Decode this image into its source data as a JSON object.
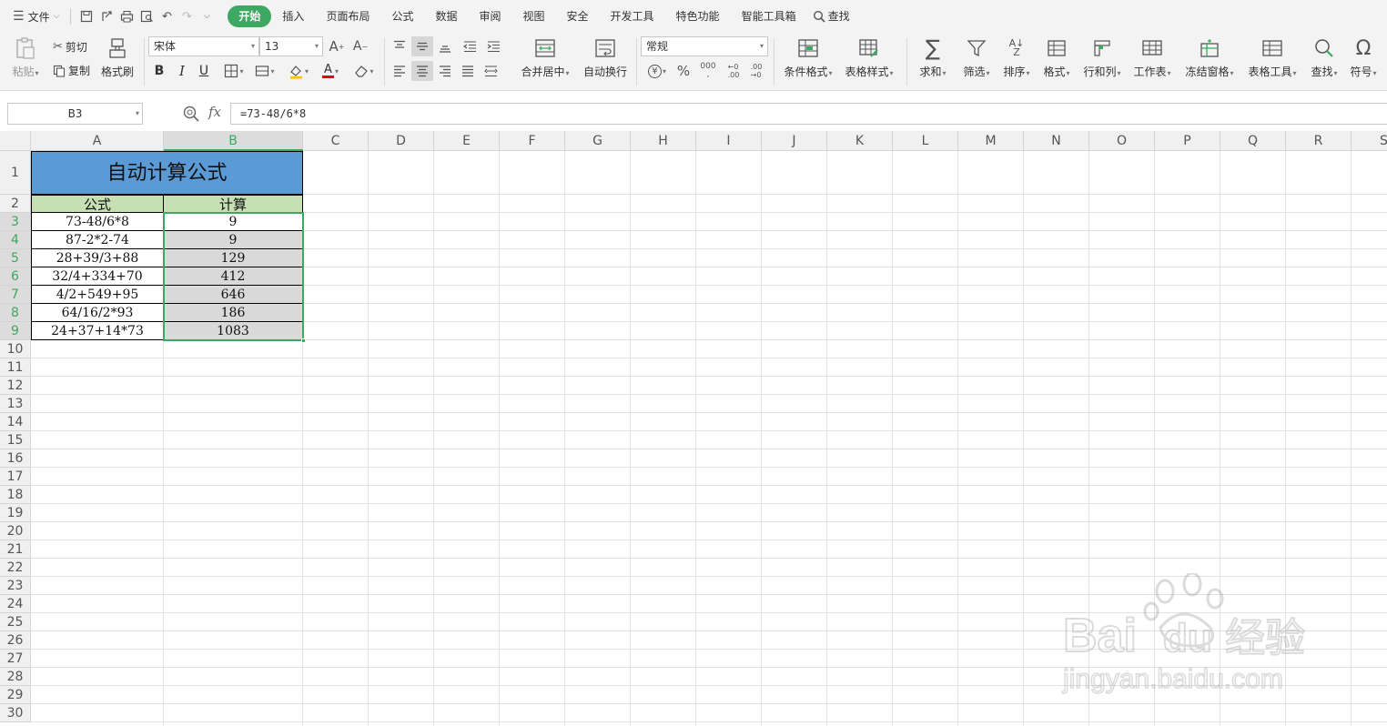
{
  "menu": {
    "file_label": "文件",
    "tabs": [
      "开始",
      "插入",
      "页面布局",
      "公式",
      "数据",
      "审阅",
      "视图",
      "安全",
      "开发工具",
      "特色功能",
      "智能工具箱"
    ],
    "active_tab": "开始",
    "search_label": "查找"
  },
  "ribbon": {
    "paste": "粘贴",
    "cut": "剪切",
    "copy": "复制",
    "format_painter": "格式刷",
    "font_name": "宋体",
    "font_size": "13",
    "merge_center": "合并居中",
    "wrap_text": "自动换行",
    "number_format": "常规",
    "conditional_format": "条件格式",
    "table_style": "表格样式",
    "sum": "求和",
    "filter": "筛选",
    "sort": "排序",
    "format": "格式",
    "rows_cols": "行和列",
    "worksheet": "工作表",
    "freeze": "冻结窗格",
    "table_tools": "表格工具",
    "find": "查找",
    "symbol": "符号"
  },
  "formula_bar": {
    "name_box": "B3",
    "fx": "fx",
    "formula": "=73-48/6*8"
  },
  "sheet": {
    "columns": [
      "A",
      "B",
      "C",
      "D",
      "E",
      "F",
      "G",
      "H",
      "I",
      "J",
      "K",
      "L",
      "M",
      "N",
      "O",
      "P",
      "Q",
      "R",
      "S"
    ],
    "selected_column": "B",
    "title": "自动计算公式",
    "header_formula": "公式",
    "header_calc": "计算",
    "rows": [
      {
        "formula": "73-48/6*8",
        "result": "9"
      },
      {
        "formula": "87-2*2-74",
        "result": "9"
      },
      {
        "formula": "28+39/3+88",
        "result": "129"
      },
      {
        "formula": "32/4+334+70",
        "result": "412"
      },
      {
        "formula": "4/2+549+95",
        "result": "646"
      },
      {
        "formula": "64/16/2*93",
        "result": "186"
      },
      {
        "formula": "24+37+14*73",
        "result": "1083"
      }
    ],
    "row_count": 30,
    "colors": {
      "title_fill": "#5b9bd5",
      "header_fill": "#c6e0b4",
      "selection_fill": "#d9d9d9",
      "selection_border": "#3ca861"
    }
  },
  "watermark": {
    "brand": "Bai",
    "brand2": "du",
    "cn": "经验",
    "url": "jingyan.baidu.com"
  }
}
